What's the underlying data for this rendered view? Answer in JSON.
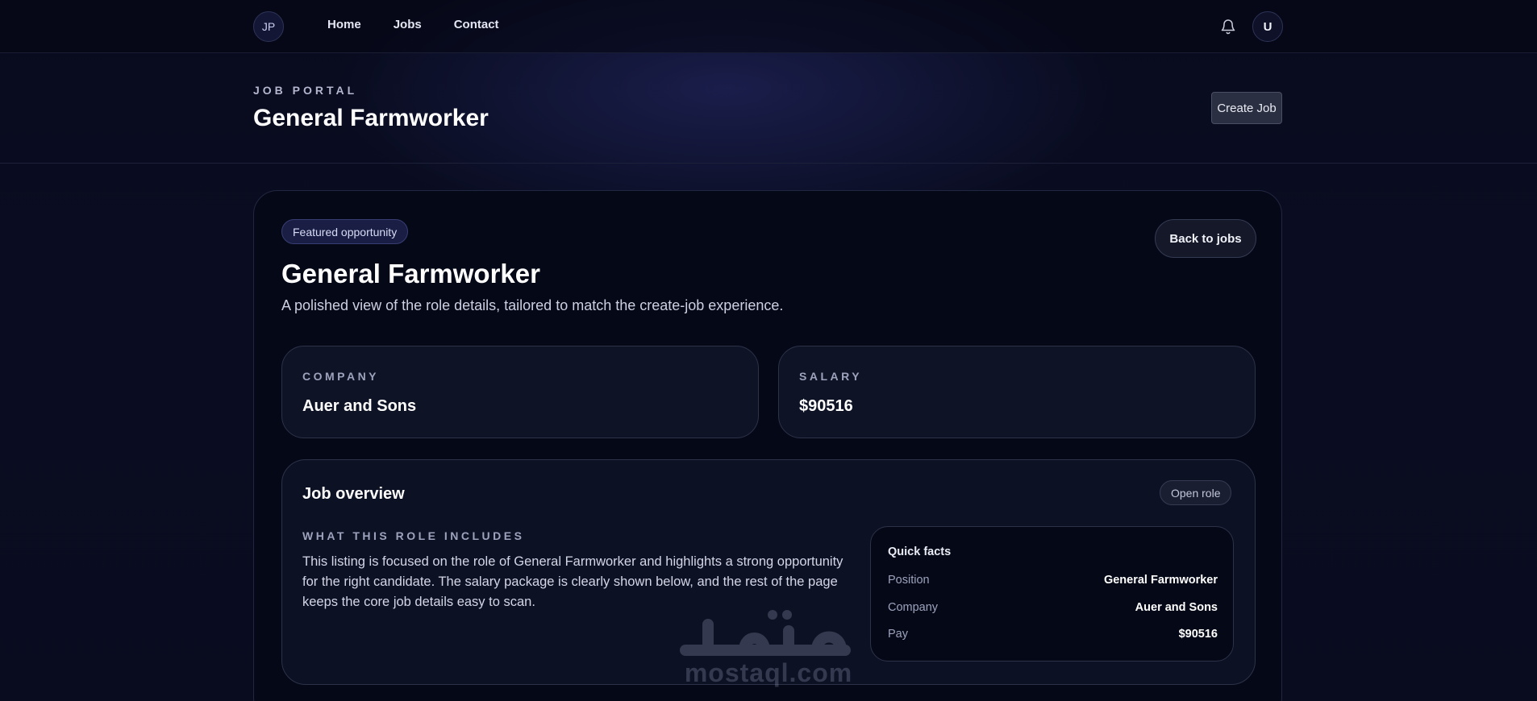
{
  "nav": {
    "logo": "JP",
    "links": [
      "Home",
      "Jobs",
      "Contact"
    ],
    "bell_icon": "bell-icon",
    "user_initial": "U"
  },
  "header": {
    "eyebrow": "JOB PORTAL",
    "title": "General Farmworker",
    "create_button": "Create Job"
  },
  "card": {
    "badge": "Featured opportunity",
    "back_button": "Back to jobs",
    "title": "General Farmworker",
    "subtitle": "A polished view of the role details, tailored to match the create-job experience.",
    "stats": [
      {
        "label": "COMPANY",
        "value": "Auer and Sons"
      },
      {
        "label": "SALARY",
        "value": "$90516"
      }
    ],
    "overview": {
      "title": "Job overview",
      "status": "Open role",
      "eyebrow": "WHAT THIS ROLE INCLUDES",
      "description": "This listing is focused on the role of General Farmworker and highlights a strong opportunity for the right candidate. The salary package is clearly shown below, and the rest of the page keeps the core job details easy to scan.",
      "quick_facts": {
        "title": "Quick facts",
        "rows": [
          {
            "key": "Position",
            "value": "General Farmworker"
          },
          {
            "key": "Company",
            "value": "Auer and Sons"
          },
          {
            "key": "Pay",
            "value": "$90516"
          }
        ]
      }
    }
  },
  "watermark": {
    "text": "mostaql.com"
  },
  "colors": {
    "background": "#070a1a",
    "card": "#050817",
    "panel": "#0f1326",
    "accent_badge": "#1a1e44",
    "text_primary": "#ffffff",
    "text_muted": "#9ea3bd"
  }
}
